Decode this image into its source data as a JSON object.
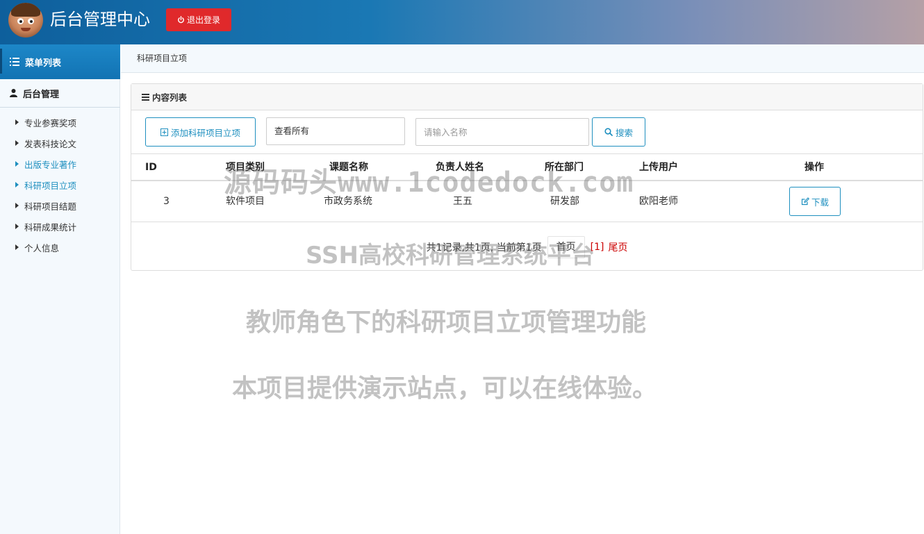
{
  "header": {
    "title": "后台管理中心",
    "logout_label": "退出登录"
  },
  "sidebar": {
    "heading": "菜单列表",
    "section": "后台管理",
    "items": [
      {
        "label": "专业参赛奖项",
        "active": false
      },
      {
        "label": "发表科技论文",
        "active": false
      },
      {
        "label": "出版专业著作",
        "active": true
      },
      {
        "label": "科研项目立项",
        "active": true
      },
      {
        "label": "科研项目结题",
        "active": false
      },
      {
        "label": "科研成果统计",
        "active": false
      },
      {
        "label": "个人信息",
        "active": false
      }
    ]
  },
  "breadcrumb": "科研项目立项",
  "panel": {
    "title": "内容列表",
    "add_label": "添加科研项目立项",
    "filter_value": "查看所有",
    "search_placeholder": "请输入名称",
    "search_label": "搜索"
  },
  "table": {
    "columns": [
      "ID",
      "项目类别",
      "课题名称",
      "负责人姓名",
      "所在部门",
      "上传用户",
      "操作"
    ],
    "rows": [
      {
        "id": "3",
        "category": "软件项目",
        "topic": "市政务系统",
        "leader": "王五",
        "dept": "研发部",
        "uploader": "欧阳老师",
        "action": "下载"
      }
    ]
  },
  "pager": {
    "summary": "共1记录,共1页, 当前第1页",
    "first": "首页",
    "current": "[1]",
    "last": "尾页"
  },
  "watermarks": {
    "line1": "源码码头www.1codedock.com",
    "line2": "SSH高校科研管理系统平台",
    "line3": "教师角色下的科研项目立项管理功能",
    "line4": "本项目提供演示站点，可以在线体验。"
  },
  "colors": {
    "accent": "#1e8fbf",
    "danger": "#e0292b",
    "header_start": "#0e5f9c",
    "header_end": "#b5a0a6"
  }
}
